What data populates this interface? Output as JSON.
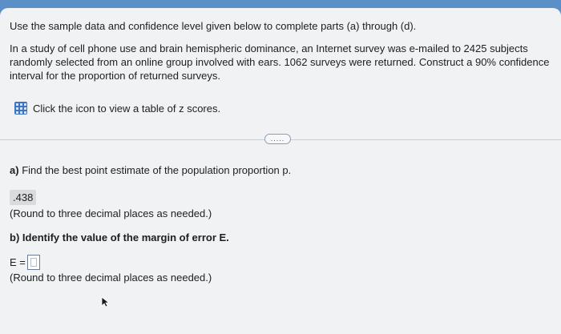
{
  "question": {
    "instructions": "Use the sample data and confidence level given below to complete parts (a) through (d).",
    "problem_lines": [
      "In a study of cell phone use and brain hemispheric dominance, an Internet survey was e-mailed to 2425 subjects",
      "randomly selected from an online group involved with ears. 1062 surveys were returned. Construct a 90% confidence",
      "interval for the proportion of returned surveys."
    ],
    "ztable_link": "Click the icon to view a table of z scores.",
    "expand_label": "....."
  },
  "part_a": {
    "label": "a)",
    "prompt": "Find the best point estimate of the population proportion p.",
    "answer": ".438",
    "note": "(Round to three decimal places as needed.)"
  },
  "part_b": {
    "label": "b)",
    "prompt": "Identify the value of the margin of error E.",
    "field_label": "E =",
    "answer": "",
    "note": "(Round to three decimal places as needed.)"
  },
  "icons": {
    "ztable": "table-grid-icon",
    "cursor": "mouse-pointer-icon"
  },
  "colors": {
    "header": "#5b8fc7",
    "icon": "#3f73c4",
    "answer_fill": "#d9dbde"
  }
}
